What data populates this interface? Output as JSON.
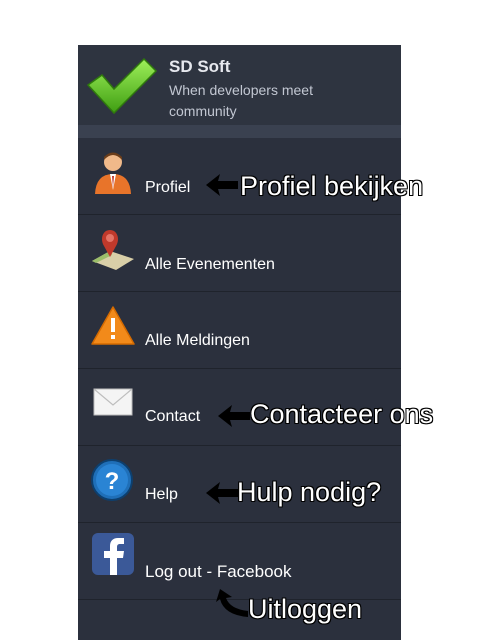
{
  "header": {
    "app_name": "SD Soft",
    "tagline": "When developers meet community",
    "logo_icon": "checkmark-icon"
  },
  "menu": {
    "items": [
      {
        "label": "Profiel",
        "icon": "user-profile-icon"
      },
      {
        "label": "Alle Evenementen",
        "icon": "map-pin-icon"
      },
      {
        "label": "Alle Meldingen",
        "icon": "warning-icon"
      },
      {
        "label": "Contact",
        "icon": "envelope-icon"
      },
      {
        "label": "Help",
        "icon": "help-icon"
      },
      {
        "label": "Log out - Facebook",
        "icon": "facebook-icon"
      }
    ]
  },
  "annotations": {
    "profile": "Profiel bekijken",
    "contact": "Contacteer ons",
    "help": "Hulp nodig?",
    "logout": "Uitloggen"
  },
  "colors": {
    "panel_bg": "#2b303d",
    "check_green": "#6fd12b",
    "facebook_blue": "#3b5998",
    "warning_orange": "#f28a1a",
    "help_blue": "#1f6fb8"
  }
}
